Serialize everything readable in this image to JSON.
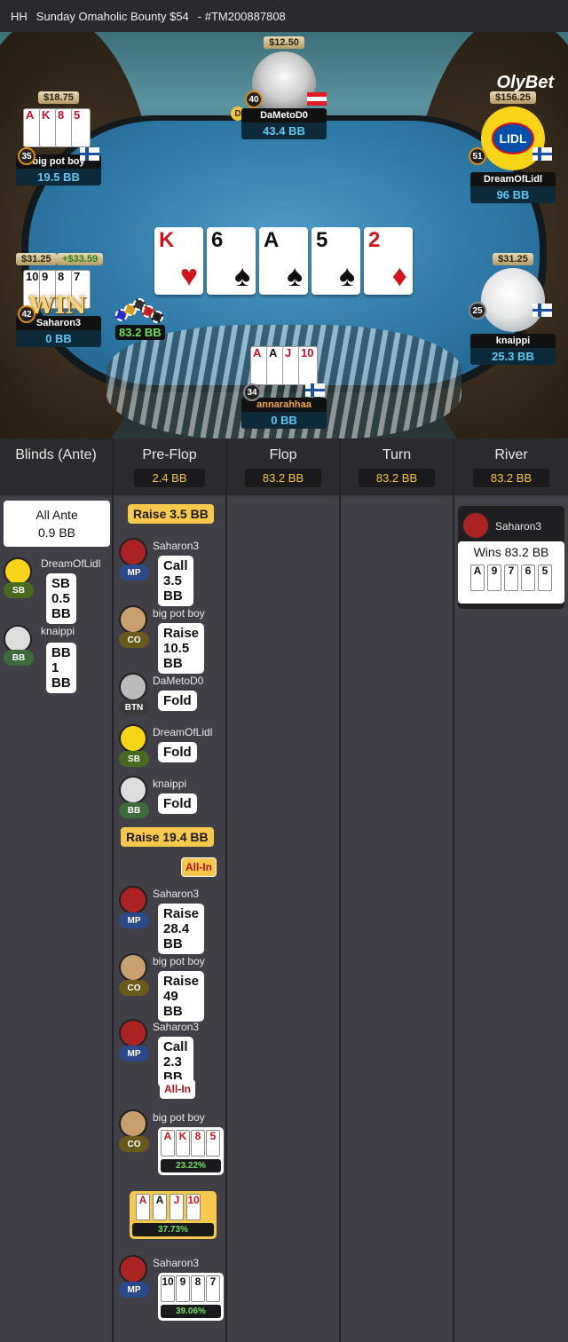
{
  "titlebar": {
    "prefix": "HH",
    "title": "Sunday Omaholic Bounty $54",
    "hand_id": "- #TM200887808"
  },
  "brand": "OlyBet",
  "colors": {
    "accent": "#f6c94c",
    "bb_text": "#5ec8f0",
    "pot_text": "#6ee05a"
  },
  "seats": {
    "top": {
      "stack": "$12.50",
      "level": "40",
      "name": "DaMetoD0",
      "bb": "43.4 BB",
      "flag": "austria",
      "dealer": "D"
    },
    "left_top": {
      "stack": "$18.75",
      "level": "35",
      "name": "big pot boy",
      "bb": "19.5 BB",
      "flag": "finland",
      "cards": [
        {
          "r": "A",
          "c": "red"
        },
        {
          "r": "K",
          "c": "red"
        },
        {
          "r": "8",
          "c": "red"
        },
        {
          "r": "5",
          "c": "red"
        }
      ]
    },
    "right_top": {
      "stack": "$156.25",
      "level": "51",
      "name": "DreamOfLidl",
      "bb": "96 BB",
      "flag": "finland",
      "avatar": "LIDL"
    },
    "left_mid": {
      "stack": "$31.25",
      "bounty_won": "+$33.59",
      "level": "42",
      "name": "Saharon3",
      "bb": "0 BB",
      "win_text": "WIN",
      "cards": [
        {
          "r": "10",
          "c": "blk"
        },
        {
          "r": "9",
          "c": "blk"
        },
        {
          "r": "8",
          "c": "blk"
        },
        {
          "r": "7",
          "c": "blk"
        }
      ]
    },
    "right_mid": {
      "stack": "$31.25",
      "level": "25",
      "name": "knaippi",
      "bb": "25.3 BB",
      "flag": "finland"
    },
    "bottom": {
      "level": "34",
      "name": "annarahhaa",
      "bb": "0 BB",
      "flag": "finland",
      "cards": [
        {
          "r": "A",
          "c": "red"
        },
        {
          "r": "A",
          "c": "blk"
        },
        {
          "r": "J",
          "c": "red"
        },
        {
          "r": "10",
          "c": "red"
        }
      ]
    }
  },
  "board": [
    {
      "rank": "K",
      "suit": "♥",
      "color": "red"
    },
    {
      "rank": "6",
      "suit": "♠",
      "color": "blk"
    },
    {
      "rank": "A",
      "suit": "♠",
      "color": "blk"
    },
    {
      "rank": "5",
      "suit": "♠",
      "color": "blk"
    },
    {
      "rank": "2",
      "suit": "♦",
      "color": "red"
    }
  ],
  "pot": "83.2 BB",
  "history": {
    "columns": [
      {
        "title": "Blinds (Ante)",
        "amount": ""
      },
      {
        "title": "Pre-Flop",
        "amount": "2.4 BB"
      },
      {
        "title": "Flop",
        "amount": "83.2 BB"
      },
      {
        "title": "Turn",
        "amount": "83.2 BB"
      },
      {
        "title": "River",
        "amount": "83.2 BB"
      }
    ],
    "blinds": {
      "ante_line1": "All Ante",
      "ante_line2": "0.9 BB",
      "sb_name": "DreamOfLidl",
      "sb_pos": "SB",
      "sb_l1": "SB",
      "sb_l2": "0.5 BB",
      "bb_name": "knaippi",
      "bb_pos": "BB",
      "bb_l1": "BB 1 BB"
    },
    "preflop": {
      "raise1": "Raise 3.5 BB",
      "a1": {
        "name": "Saharon3",
        "pos": "MP",
        "l1": "Call",
        "l2": "3.5 BB"
      },
      "a2": {
        "name": "big pot boy",
        "pos": "CO",
        "l1": "Raise",
        "l2": "10.5 BB"
      },
      "a3": {
        "name": "DaMetoD0",
        "pos": "BTN",
        "l1": "Fold"
      },
      "a4": {
        "name": "DreamOfLidl",
        "pos": "SB",
        "l1": "Fold"
      },
      "a5": {
        "name": "knaippi",
        "pos": "BB",
        "l1": "Fold"
      },
      "raise2": "Raise 19.4 BB",
      "allin1": "All-In",
      "a6": {
        "name": "Saharon3",
        "pos": "MP",
        "l1": "Raise",
        "l2": "28.4 BB"
      },
      "a7": {
        "name": "big pot boy",
        "pos": "CO",
        "l1": "Raise",
        "l2": "49 BB"
      },
      "a8": {
        "name": "Saharon3",
        "pos": "MP",
        "l1": "Call",
        "l2": "2.3 BB"
      },
      "allin2": "All-In",
      "show1": {
        "name": "big pot boy",
        "pos": "CO",
        "cards": [
          "A",
          "K",
          "8",
          "5"
        ],
        "equity": "23.22%"
      },
      "show2": {
        "cards": [
          "A",
          "A",
          "J",
          "10"
        ],
        "equity": "37.73%"
      },
      "show3": {
        "name": "Saharon3",
        "pos": "MP",
        "cards": [
          "10",
          "9",
          "8",
          "7"
        ],
        "equity": "39.06%"
      }
    },
    "river": {
      "winner": "Saharon3",
      "wins": "Wins 83.2 BB",
      "cards": [
        "A",
        "9",
        "7",
        "6",
        "5"
      ]
    }
  }
}
